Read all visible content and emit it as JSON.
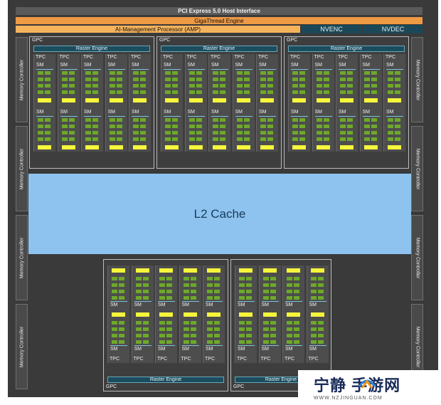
{
  "header": {
    "pcie": "PCI Express 5.0 Host Interface",
    "gigathread": "GigaThread Engine",
    "amp": "AI-Management Processor (AMP)",
    "nvenc": "NVENC",
    "nvdec": "NVDEC"
  },
  "memory_controller_label": "Memory Controller",
  "l2_cache_label": "L2 Cache",
  "gpc": {
    "label": "GPC",
    "raster_label": "Raster Engine",
    "tpc_label": "TPC",
    "sm_label": "SM"
  },
  "colors": {
    "background": "#3a3a3a",
    "pcie_bar": "#5a5a5a",
    "gigathread_bar": "#ef9a45",
    "amp_bar": "#f5b35c",
    "codec_bar": "#1b4858",
    "raster_engine": "#1b4d5e",
    "l2_cache": "#8ec3ef",
    "sm_cores": "#6ea82a",
    "rt_core": "#f5f53c"
  },
  "watermark": {
    "title": "宁静  手游网",
    "url": "WWW.NZJINGUAN.COM"
  }
}
